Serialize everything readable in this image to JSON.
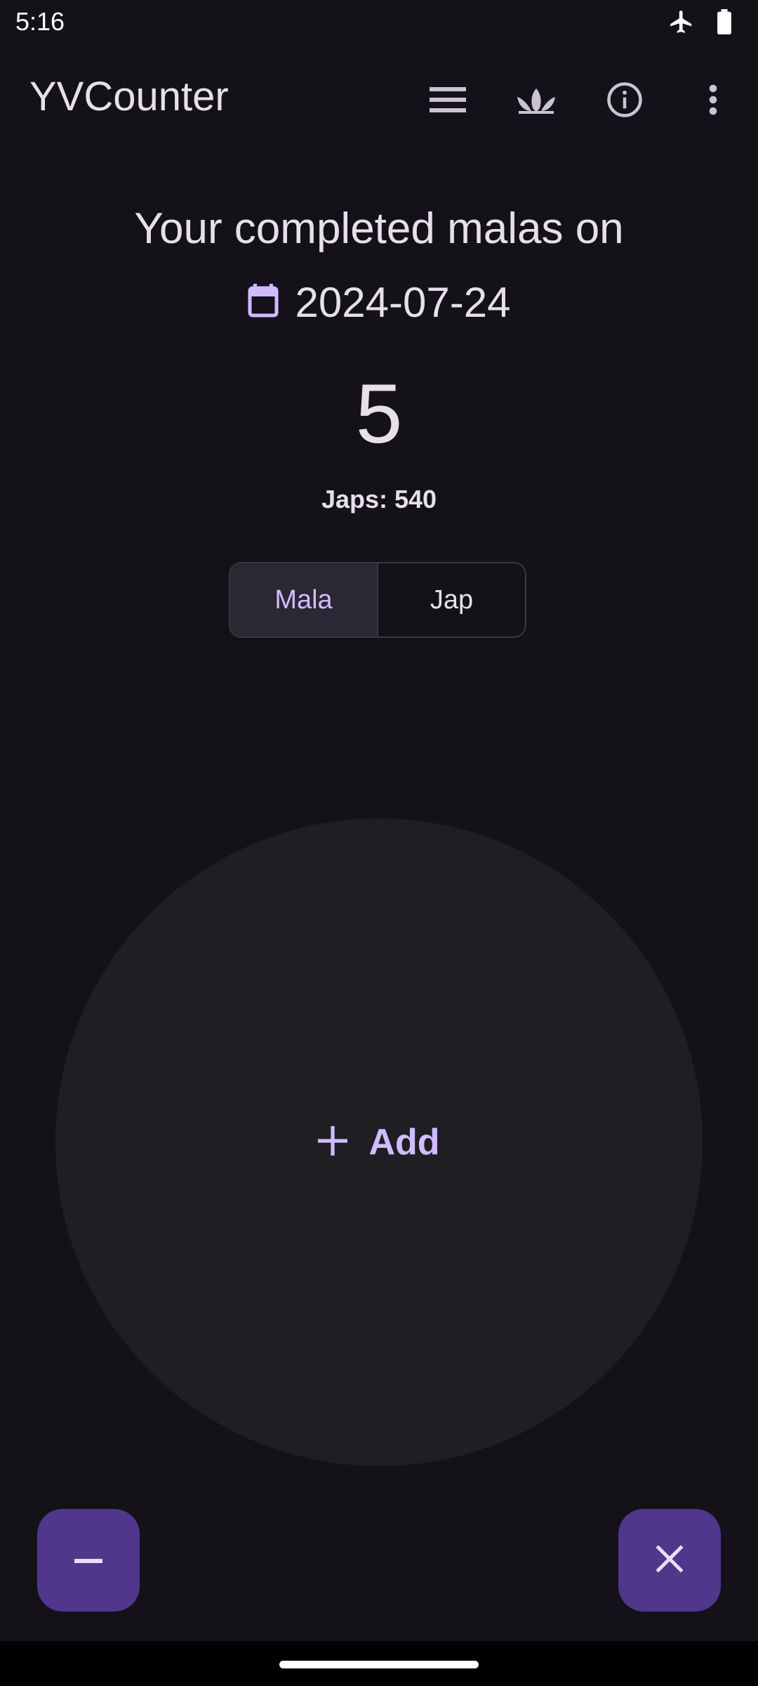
{
  "status_bar": {
    "time": "5:16",
    "icons": [
      "airplane-icon",
      "battery-icon"
    ]
  },
  "app_bar": {
    "title": "YVCounter",
    "actions": [
      "list-icon",
      "lotus-icon",
      "info-icon",
      "more-vert-icon"
    ]
  },
  "main": {
    "heading": "Your completed malas on",
    "date": "2024-07-24",
    "count": "5",
    "japs": "Japs: 540",
    "segments": [
      {
        "label": "Mala",
        "selected": true
      },
      {
        "label": "Jap",
        "selected": false
      }
    ],
    "add_label": "Add"
  },
  "fabs": {
    "left_icon": "minus-icon",
    "right_icon": "close-icon"
  },
  "colors": {
    "background": "#141218",
    "accent": "#d0bcff",
    "fab": "#4f378b",
    "circle": "#1f1e22"
  }
}
